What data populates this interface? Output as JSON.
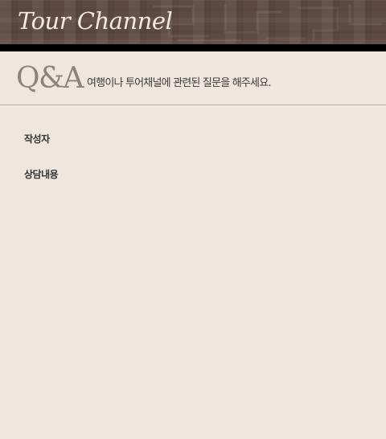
{
  "header": {
    "logo_text": "Tour Channel"
  },
  "qa_section": {
    "mark": "Q&A",
    "subtitle": "여행이나 투어채널에 관련된 질문을 해주세요."
  },
  "form": {
    "author_label": "작성자",
    "content_label": "상담내용"
  },
  "colors": {
    "header_bg": "#5e4a42",
    "page_bg": "#efe6de",
    "mark": "#8a847f"
  }
}
